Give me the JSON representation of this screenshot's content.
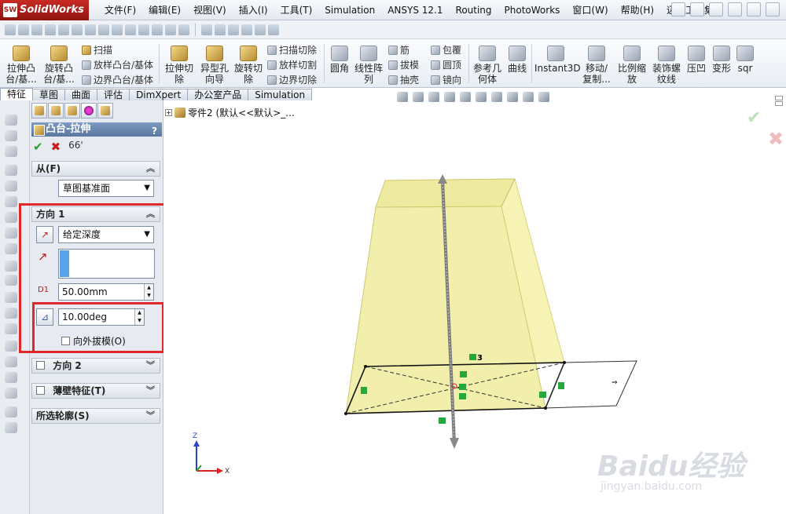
{
  "app": {
    "logo_text": "SolidWorks",
    "logo_mark": "SW"
  },
  "menu": [
    "文件(F)",
    "编辑(E)",
    "视图(V)",
    "插入(I)",
    "工具(T)",
    "Simulation",
    "ANSYS 12.1",
    "Routing",
    "PhotoWorks",
    "窗口(W)",
    "帮助(H)",
    "迈迪工具集"
  ],
  "ribbon": {
    "extrude_boss": "拉伸凸\n台/基...",
    "revolve_boss": "旋转凸\n台/基...",
    "sweep": "扫描",
    "loft": "放样凸台/基体",
    "boundary": "边界凸台/基体",
    "extrude_cut": "拉伸切\n除",
    "hole_wizard": "异型孔\n向导",
    "revolve_cut": "旋转切\n除",
    "sweep_cut": "扫描切除",
    "loft_cut": "放样切割",
    "boundary_cut": "边界切除",
    "fillet": "圆角",
    "linear_pattern": "线性阵\n列",
    "rib": "筋",
    "draft": "拔模",
    "shell": "抽壳",
    "wrap": "包覆",
    "dome": "圆顶",
    "mirror": "镜向",
    "ref_geometry": "参考几\n何体",
    "curves": "曲线",
    "instant3d": "Instant3D",
    "move_copy": "移动/\n复制...",
    "scale": "比例缩\n放",
    "cosmetic_thread": "装饰螺\n纹线",
    "indent": "压凹",
    "deform": "变形",
    "sqr": "sqr"
  },
  "tabs": [
    "特征",
    "草图",
    "曲面",
    "评估",
    "DimXpert",
    "办公室产品",
    "Simulation"
  ],
  "property_manager": {
    "title": "凸台-拉伸",
    "help": "?",
    "from_section": "从(F)",
    "from_value": "草图基准面",
    "direction1_section": "方向 1",
    "end_condition": "给定深度",
    "depth": "50.00mm",
    "depth_label": "D1",
    "draft_angle": "10.00deg",
    "draft_outward": "向外拔模(O)",
    "direction2_section": "方向 2",
    "thin_feature_section": "薄壁特征(T)",
    "selected_contours_section": "所选轮廓(S)"
  },
  "tree": {
    "label": "零件2 (默认<<默认>_..."
  },
  "graphics": {
    "sketch_dimension_label": "3",
    "triad_z": "Z",
    "triad_x": "X"
  },
  "watermark": {
    "main": "Baidu经验",
    "sub": "jingyan.baidu.com"
  },
  "colors": {
    "highlight_red": "#e0282a",
    "body_fill": "#f4f1a8",
    "pm_title": "#6a87ae"
  }
}
